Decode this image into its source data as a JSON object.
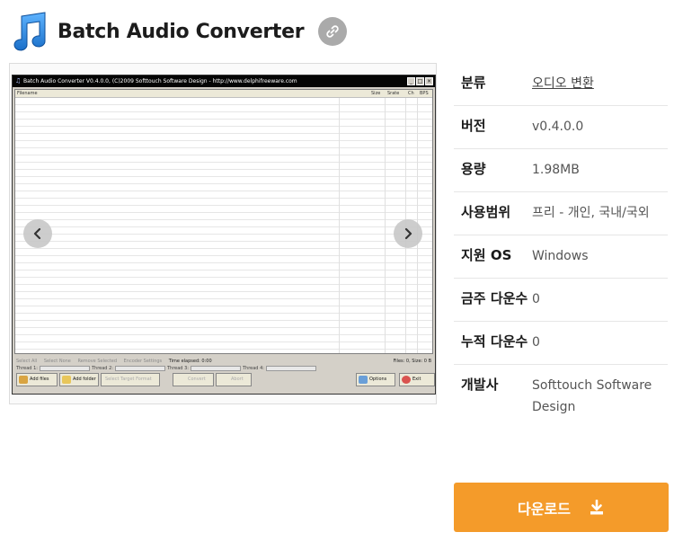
{
  "app": {
    "title": "Batch Audio Converter"
  },
  "screenshot": {
    "window_title": "Batch Audio Converter V0.4.0.0, (C)2009 Softtouch Software Design - http://www.delphifreeware.com",
    "columns": [
      "Filename",
      "Size",
      "Srate",
      "Ch",
      "BPS"
    ],
    "toolbar_links": [
      "Select All",
      "Select None",
      "Remove Selected",
      "Encoder Settings"
    ],
    "elapsed": "Time elapsed: 0:00",
    "files_info": "Files: 0, Size: 0 B",
    "threads": [
      "Thread 1:",
      "Thread 2:",
      "Thread 3:",
      "Thread 4:"
    ],
    "thread_percent": "0%",
    "buttons": {
      "add_files": "Add files",
      "add_folder": "Add folder",
      "select_format": "Select Target Format",
      "convert": "Convert",
      "abort": "Abort",
      "options": "Options",
      "exit": "Exit"
    }
  },
  "info": [
    {
      "label": "분류",
      "value": "오디오 변환"
    },
    {
      "label": "버전",
      "value": "v0.4.0.0"
    },
    {
      "label": "용량",
      "value": "1.98MB"
    },
    {
      "label": "사용범위",
      "value": "프리 - 개인, 국내/국외"
    },
    {
      "label": "지원 OS",
      "value": "Windows"
    },
    {
      "label": "금주 다운수",
      "value": "0"
    },
    {
      "label": "누적 다운수",
      "value": "0"
    },
    {
      "label": "개발사",
      "value": "Softtouch Software Design"
    }
  ],
  "download": {
    "label": "다운로드"
  },
  "colors": {
    "accent": "#f49b2a",
    "icon_blue": "#2a86d8"
  },
  "icons": {
    "app": "music-note-icon",
    "link": "link-icon",
    "prev": "chevron-left-icon",
    "next": "chevron-right-icon",
    "download": "download-icon"
  }
}
